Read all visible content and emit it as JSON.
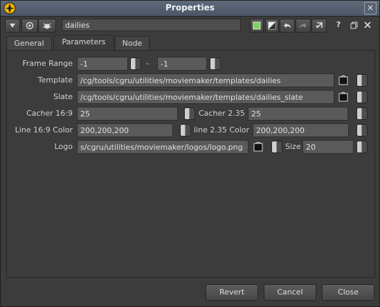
{
  "window": {
    "title": "Properties",
    "close_glyph": "×"
  },
  "toolbar": {
    "node_name": "dailies",
    "help_glyph": "?",
    "icons": [
      "menu-arrow-icon",
      "view-target-icon",
      "node-bug-icon",
      "color-square-icon",
      "half-tone-icon",
      "undo-icon",
      "redo-icon",
      "refresh-icon",
      "help-icon",
      "float-icon",
      "close-icon"
    ]
  },
  "tabs": [
    {
      "label": "General",
      "active": false
    },
    {
      "label": "Parameters",
      "active": true
    },
    {
      "label": "Node",
      "active": false
    }
  ],
  "params": {
    "frame_range": {
      "label": "Frame Range",
      "from": "-1",
      "separator": "-",
      "to": "-1"
    },
    "template": {
      "label": "Template",
      "value": "/cg/tools/cgru/utilities/moviemaker/templates/dailies"
    },
    "slate": {
      "label": "Slate",
      "value": "/cg/tools/cgru/utilities/moviemaker/templates/dailies_slate"
    },
    "cacher169": {
      "label": "Cacher 16:9",
      "value": "25"
    },
    "cacher235": {
      "label": "Cacher 2.35",
      "value": "25"
    },
    "line169": {
      "label": "Line 16:9 Color",
      "value": "200,200,200"
    },
    "line235": {
      "label": "line 2.35 Color",
      "value": "200,200,200"
    },
    "logo": {
      "label": "Logo",
      "value": "s/cgru/utilities/moviemaker/logos/logo.png"
    },
    "size": {
      "label": "Size",
      "value": "20"
    }
  },
  "buttons": {
    "revert": "Revert",
    "cancel": "Cancel",
    "close": "Close"
  },
  "colors": {
    "accent_green": "#7ccf5a",
    "title_bar": "#55606f"
  }
}
